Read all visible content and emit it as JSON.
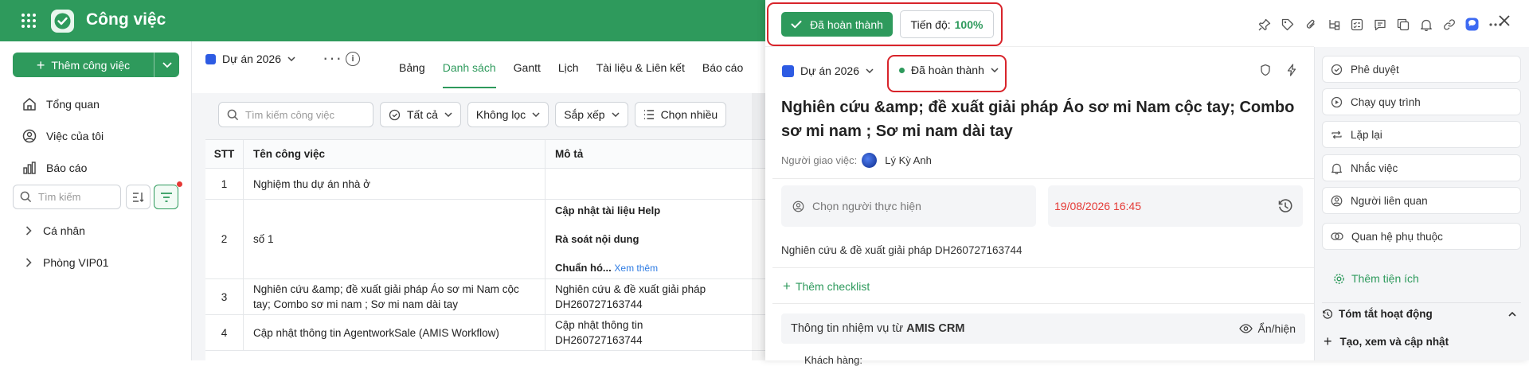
{
  "app": {
    "title": "Công việc"
  },
  "sidebar": {
    "add_button": "Thêm công việc",
    "nav": [
      {
        "label": "Tổng quan",
        "icon": "home-icon"
      },
      {
        "label": "Việc của tôi",
        "icon": "user-circle-icon"
      },
      {
        "label": "Báo cáo",
        "icon": "bar-chart-icon"
      }
    ],
    "search_placeholder": "Tìm kiếm",
    "tree": [
      {
        "label": "Cá nhân"
      },
      {
        "label": "Phòng VIP01"
      }
    ]
  },
  "main": {
    "project": "Dự án 2026",
    "tabs": [
      "Bảng",
      "Danh sách",
      "Gantt",
      "Lịch",
      "Tài liệu & Liên kết",
      "Báo cáo"
    ],
    "active_tab": "Danh sách",
    "search_placeholder": "Tìm kiếm công việc",
    "filters": {
      "all": "Tất cả",
      "nofilter": "Không lọc",
      "sort": "Sắp xếp",
      "multi": "Chọn nhiều"
    },
    "table": {
      "columns": [
        "STT",
        "Tên công việc",
        "Mô tả"
      ],
      "rows": [
        {
          "stt": "1",
          "name": "Nghiệm thu dự án nhà ở",
          "desc": ""
        },
        {
          "stt": "2",
          "name": "số 1",
          "desc_lines": [
            "Cập nhật tài liệu Help",
            "Rà soát nội dung",
            "Chuẩn hó..."
          ],
          "more": "Xem thêm"
        },
        {
          "stt": "3",
          "name": "Nghiên cứu &amp; đề xuất giải pháp Áo sơ mi Nam cộc tay; Combo sơ mi nam ; Sơ mi nam dài tay",
          "desc": "Nghiên cứu & đề xuất giải pháp DH260727163744"
        },
        {
          "stt": "4",
          "name": "Cập nhật thông tin AgentworkSale (AMIS Workflow)",
          "desc": "Cập nhật thông tin DH260727163744"
        }
      ]
    }
  },
  "panel": {
    "done_button": "Đã hoàn thành",
    "progress_label": "Tiến độ:",
    "progress_value": "100%",
    "project": "Dự án 2026",
    "status": "Đã hoàn thành",
    "title": "Nghiên cứu &amp; đề xuất giải pháp Áo sơ mi Nam cộc tay; Combo sơ mi nam ; Sơ mi nam dài tay",
    "assigner_label": "Người giao việc:",
    "assigner_name": "Lý Kỳ Anh",
    "performer_placeholder": "Chọn người thực hiện",
    "due_date": "19/08/2026 16:45",
    "description": "Nghiên cứu & đề xuất giải pháp DH260727163744",
    "add_checklist": "Thêm checklist",
    "crm_prefix": "Thông tin nhiệm vụ từ",
    "crm_name": "AMIS CRM",
    "toggle_label": "Ẩn/hiện",
    "customer_label": "Khách hàng:"
  },
  "right_panel": {
    "actions": [
      {
        "label": "Phê duyệt",
        "icon": "check-circle-icon"
      },
      {
        "label": "Chạy quy trình",
        "icon": "play-circle-icon"
      },
      {
        "label": "Lặp lại",
        "icon": "repeat-icon"
      },
      {
        "label": "Nhắc việc",
        "icon": "bell-icon"
      },
      {
        "label": "Người liên quan",
        "icon": "user-circle-icon"
      },
      {
        "label": "Quan hệ phụ thuộc",
        "icon": "link-icon"
      }
    ],
    "add_utility": "Thêm tiện ích",
    "summary": "Tóm tắt hoạt động",
    "create": "Tạo, xem và cập nhật"
  },
  "colors": {
    "brand": "#2e9a5c",
    "danger": "#e53935",
    "highlight": "#d8242b"
  }
}
